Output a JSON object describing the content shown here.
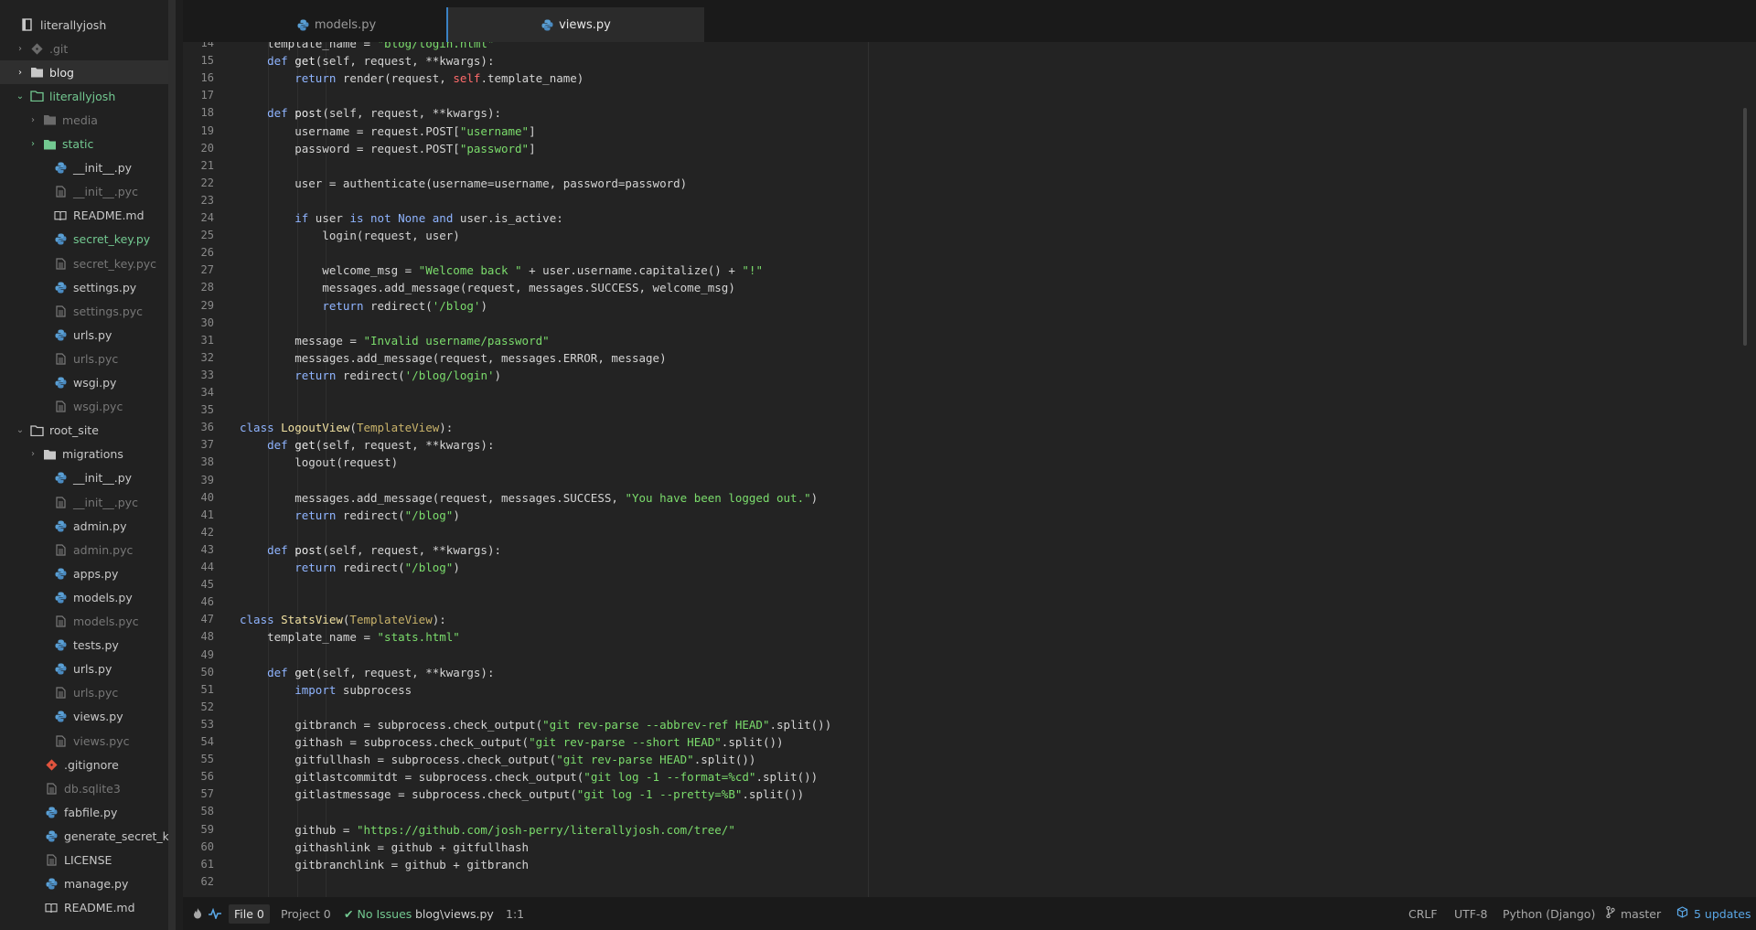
{
  "project": {
    "root": "literallyjosh",
    "tree": [
      {
        "label": ".git",
        "kind": "folder-git",
        "depth": 1,
        "chev": "right",
        "style": "dim"
      },
      {
        "label": "blog",
        "kind": "folder",
        "depth": 1,
        "chev": "right",
        "style": "white",
        "selected": true
      },
      {
        "label": "literallyjosh",
        "kind": "folder-open",
        "depth": 1,
        "chev": "down",
        "style": "green"
      },
      {
        "label": "media",
        "kind": "folder",
        "depth": 2,
        "chev": "right",
        "style": "dim"
      },
      {
        "label": "static",
        "kind": "folder-green",
        "depth": 2,
        "chev": "right",
        "style": "green"
      },
      {
        "label": "__init__.py",
        "kind": "python",
        "depth": 3,
        "style": "normal"
      },
      {
        "label": "__init__.pyc",
        "kind": "file",
        "depth": 3,
        "style": "dim"
      },
      {
        "label": "README.md",
        "kind": "book",
        "depth": 3,
        "style": "normal"
      },
      {
        "label": "secret_key.py",
        "kind": "python",
        "depth": 3,
        "style": "green"
      },
      {
        "label": "secret_key.pyc",
        "kind": "file",
        "depth": 3,
        "style": "dim"
      },
      {
        "label": "settings.py",
        "kind": "python",
        "depth": 3,
        "style": "normal"
      },
      {
        "label": "settings.pyc",
        "kind": "file",
        "depth": 3,
        "style": "dim"
      },
      {
        "label": "urls.py",
        "kind": "python",
        "depth": 3,
        "style": "normal"
      },
      {
        "label": "urls.pyc",
        "kind": "file",
        "depth": 3,
        "style": "dim"
      },
      {
        "label": "wsgi.py",
        "kind": "python",
        "depth": 3,
        "style": "normal"
      },
      {
        "label": "wsgi.pyc",
        "kind": "file",
        "depth": 3,
        "style": "dim"
      },
      {
        "label": "root_site",
        "kind": "folder-open",
        "depth": 1,
        "chev": "down",
        "style": "normal"
      },
      {
        "label": "migrations",
        "kind": "folder",
        "depth": 2,
        "chev": "right",
        "style": "normal"
      },
      {
        "label": "__init__.py",
        "kind": "python",
        "depth": 3,
        "style": "normal"
      },
      {
        "label": "__init__.pyc",
        "kind": "file",
        "depth": 3,
        "style": "dim"
      },
      {
        "label": "admin.py",
        "kind": "python",
        "depth": 3,
        "style": "normal"
      },
      {
        "label": "admin.pyc",
        "kind": "file",
        "depth": 3,
        "style": "dim"
      },
      {
        "label": "apps.py",
        "kind": "python",
        "depth": 3,
        "style": "normal"
      },
      {
        "label": "models.py",
        "kind": "python",
        "depth": 3,
        "style": "normal"
      },
      {
        "label": "models.pyc",
        "kind": "file",
        "depth": 3,
        "style": "dim"
      },
      {
        "label": "tests.py",
        "kind": "python",
        "depth": 3,
        "style": "normal"
      },
      {
        "label": "urls.py",
        "kind": "python",
        "depth": 3,
        "style": "normal"
      },
      {
        "label": "urls.pyc",
        "kind": "file",
        "depth": 3,
        "style": "dim"
      },
      {
        "label": "views.py",
        "kind": "python",
        "depth": 3,
        "style": "normal"
      },
      {
        "label": "views.pyc",
        "kind": "file",
        "depth": 3,
        "style": "dim"
      },
      {
        "label": ".gitignore",
        "kind": "git",
        "depth": 2,
        "style": "normal"
      },
      {
        "label": "db.sqlite3",
        "kind": "file",
        "depth": 2,
        "style": "dim"
      },
      {
        "label": "fabfile.py",
        "kind": "python",
        "depth": 2,
        "style": "normal"
      },
      {
        "label": "generate_secret_key.py",
        "kind": "python",
        "depth": 2,
        "style": "normal"
      },
      {
        "label": "LICENSE",
        "kind": "file",
        "depth": 2,
        "style": "normal"
      },
      {
        "label": "manage.py",
        "kind": "python",
        "depth": 2,
        "style": "normal"
      },
      {
        "label": "README.md",
        "kind": "book",
        "depth": 2,
        "style": "normal"
      }
    ]
  },
  "tabs": [
    {
      "label": "models.py",
      "active": false
    },
    {
      "label": "views.py",
      "active": true
    }
  ],
  "editor": {
    "first_line": 14,
    "lines": [
      [
        [
          "op",
          "    template_name = "
        ],
        [
          "str",
          "\"blog/login.html\""
        ]
      ],
      [
        [
          "op",
          "    "
        ],
        [
          "kw",
          "def "
        ],
        [
          "fn",
          "get"
        ],
        [
          "op",
          "(self, request, **kwargs):"
        ]
      ],
      [
        [
          "op",
          "        "
        ],
        [
          "kw",
          "return "
        ],
        [
          "call",
          "render"
        ],
        [
          "op",
          "(request, "
        ],
        [
          "self",
          "self"
        ],
        [
          "op",
          ".template_name)"
        ]
      ],
      [],
      [
        [
          "op",
          "    "
        ],
        [
          "kw",
          "def "
        ],
        [
          "fn",
          "post"
        ],
        [
          "op",
          "(self, request, **kwargs):"
        ]
      ],
      [
        [
          "op",
          "        username = request.POST["
        ],
        [
          "str",
          "\"username\""
        ],
        [
          "op",
          "]"
        ]
      ],
      [
        [
          "op",
          "        password = request.POST["
        ],
        [
          "str",
          "\"password\""
        ],
        [
          "op",
          "]"
        ]
      ],
      [],
      [
        [
          "op",
          "        user = authenticate(username=username, password=password)"
        ]
      ],
      [],
      [
        [
          "op",
          "        "
        ],
        [
          "kw",
          "if "
        ],
        [
          "op",
          "user "
        ],
        [
          "kw",
          "is not "
        ],
        [
          "kw",
          "None "
        ],
        [
          "kw",
          "and "
        ],
        [
          "op",
          "user.is_active:"
        ]
      ],
      [
        [
          "op",
          "            login(request, user)"
        ]
      ],
      [],
      [
        [
          "op",
          "            welcome_msg = "
        ],
        [
          "str",
          "\"Welcome back \""
        ],
        [
          "op",
          " + user.username.capitalize() + "
        ],
        [
          "str",
          "\"!\""
        ]
      ],
      [
        [
          "op",
          "            messages.add_message(request, messages.SUCCESS, welcome_msg)"
        ]
      ],
      [
        [
          "op",
          "            "
        ],
        [
          "kw",
          "return "
        ],
        [
          "call",
          "redirect"
        ],
        [
          "op",
          "("
        ],
        [
          "str",
          "'/blog'"
        ],
        [
          "op",
          ")"
        ]
      ],
      [],
      [
        [
          "op",
          "        message = "
        ],
        [
          "str",
          "\"Invalid username/password\""
        ]
      ],
      [
        [
          "op",
          "        messages.add_message(request, messages.ERROR, message)"
        ]
      ],
      [
        [
          "op",
          "        "
        ],
        [
          "kw",
          "return "
        ],
        [
          "call",
          "redirect"
        ],
        [
          "op",
          "("
        ],
        [
          "str",
          "'/blog/login'"
        ],
        [
          "op",
          ")"
        ]
      ],
      [],
      [],
      [
        [
          "kw",
          "class "
        ],
        [
          "cls",
          "LogoutView"
        ],
        [
          "op",
          "("
        ],
        [
          "base",
          "TemplateView"
        ],
        [
          "op",
          "):"
        ]
      ],
      [
        [
          "op",
          "    "
        ],
        [
          "kw",
          "def "
        ],
        [
          "fn",
          "get"
        ],
        [
          "op",
          "(self, request, **kwargs):"
        ]
      ],
      [
        [
          "op",
          "        logout(request)"
        ]
      ],
      [],
      [
        [
          "op",
          "        messages.add_message(request, messages.SUCCESS, "
        ],
        [
          "str",
          "\"You have been logged out.\""
        ],
        [
          "op",
          ")"
        ]
      ],
      [
        [
          "op",
          "        "
        ],
        [
          "kw",
          "return "
        ],
        [
          "call",
          "redirect"
        ],
        [
          "op",
          "("
        ],
        [
          "str",
          "\"/blog\""
        ],
        [
          "op",
          ")"
        ]
      ],
      [],
      [
        [
          "op",
          "    "
        ],
        [
          "kw",
          "def "
        ],
        [
          "fn",
          "post"
        ],
        [
          "op",
          "(self, request, **kwargs):"
        ]
      ],
      [
        [
          "op",
          "        "
        ],
        [
          "kw",
          "return "
        ],
        [
          "call",
          "redirect"
        ],
        [
          "op",
          "("
        ],
        [
          "str",
          "\"/blog\""
        ],
        [
          "op",
          ")"
        ]
      ],
      [],
      [],
      [
        [
          "kw",
          "class "
        ],
        [
          "cls",
          "StatsView"
        ],
        [
          "op",
          "("
        ],
        [
          "base",
          "TemplateView"
        ],
        [
          "op",
          "):"
        ]
      ],
      [
        [
          "op",
          "    template_name = "
        ],
        [
          "str",
          "\"stats.html\""
        ]
      ],
      [],
      [
        [
          "op",
          "    "
        ],
        [
          "kw",
          "def "
        ],
        [
          "fn",
          "get"
        ],
        [
          "op",
          "(self, request, **kwargs):"
        ]
      ],
      [
        [
          "op",
          "        "
        ],
        [
          "kw",
          "import "
        ],
        [
          "op",
          "subprocess"
        ]
      ],
      [],
      [
        [
          "op",
          "        gitbranch = subprocess.check_output("
        ],
        [
          "str",
          "\"git rev-parse --abbrev-ref HEAD\""
        ],
        [
          "op",
          ".split())"
        ]
      ],
      [
        [
          "op",
          "        githash = subprocess.check_output("
        ],
        [
          "str",
          "\"git rev-parse --short HEAD\""
        ],
        [
          "op",
          ".split())"
        ]
      ],
      [
        [
          "op",
          "        gitfullhash = subprocess.check_output("
        ],
        [
          "str",
          "\"git rev-parse HEAD\""
        ],
        [
          "op",
          ".split())"
        ]
      ],
      [
        [
          "op",
          "        gitlastcommitdt = subprocess.check_output("
        ],
        [
          "str",
          "\"git log -1 --format=%cd\""
        ],
        [
          "op",
          ".split())"
        ]
      ],
      [
        [
          "op",
          "        gitlastmessage = subprocess.check_output("
        ],
        [
          "str",
          "\"git log -1 --pretty=%B\""
        ],
        [
          "op",
          ".split())"
        ]
      ],
      [],
      [
        [
          "op",
          "        github = "
        ],
        [
          "str",
          "\"https://github.com/josh-perry/literallyjosh.com/tree/\""
        ]
      ],
      [
        [
          "op",
          "        githashlink = github + gitfullhash"
        ]
      ],
      [
        [
          "op",
          "        gitbranchlink = github + gitbranch"
        ]
      ],
      []
    ]
  },
  "status": {
    "file_label": "File",
    "file_count": "0",
    "project_label": "Project",
    "project_count": "0",
    "issues": "No Issues",
    "path": "blog\\views.py",
    "cursor": "1:1",
    "line_ending": "CRLF",
    "encoding": "UTF-8",
    "grammar": "Python (Django)",
    "branch": "master",
    "updates": "5 updates"
  },
  "colors": {
    "python_icon": "#5a9fd4",
    "folder": "#c8c8c8",
    "git_icon": "#e0533d",
    "accent": "#5aa7e6",
    "green": "#73c991"
  }
}
